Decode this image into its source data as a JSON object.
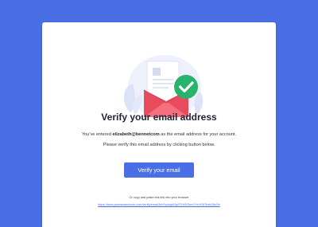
{
  "colors": {
    "background": "#4a6ee6",
    "card": "#ffffff",
    "accent": "#4a6ee6",
    "success": "#27b36b",
    "envelope": "#f15b6c"
  },
  "illustration": {
    "icon": "envelope-check-icon"
  },
  "heading": "Verify your email address",
  "message": {
    "prefix": "You've entered ",
    "email": "elizabeth@bennetcom",
    "suffix": " as the email address for your account.",
    "line2": "Please verify this email address by clicking button below."
  },
  "button_label": "Verify your email",
  "copy_text": "Or copy and paste this link into your browser",
  "link": "https://www.janeaustenlover.com/verify/emailJbhYyukqk6Jg9TH4SJkmVYcHG6TbvkSAcSe"
}
